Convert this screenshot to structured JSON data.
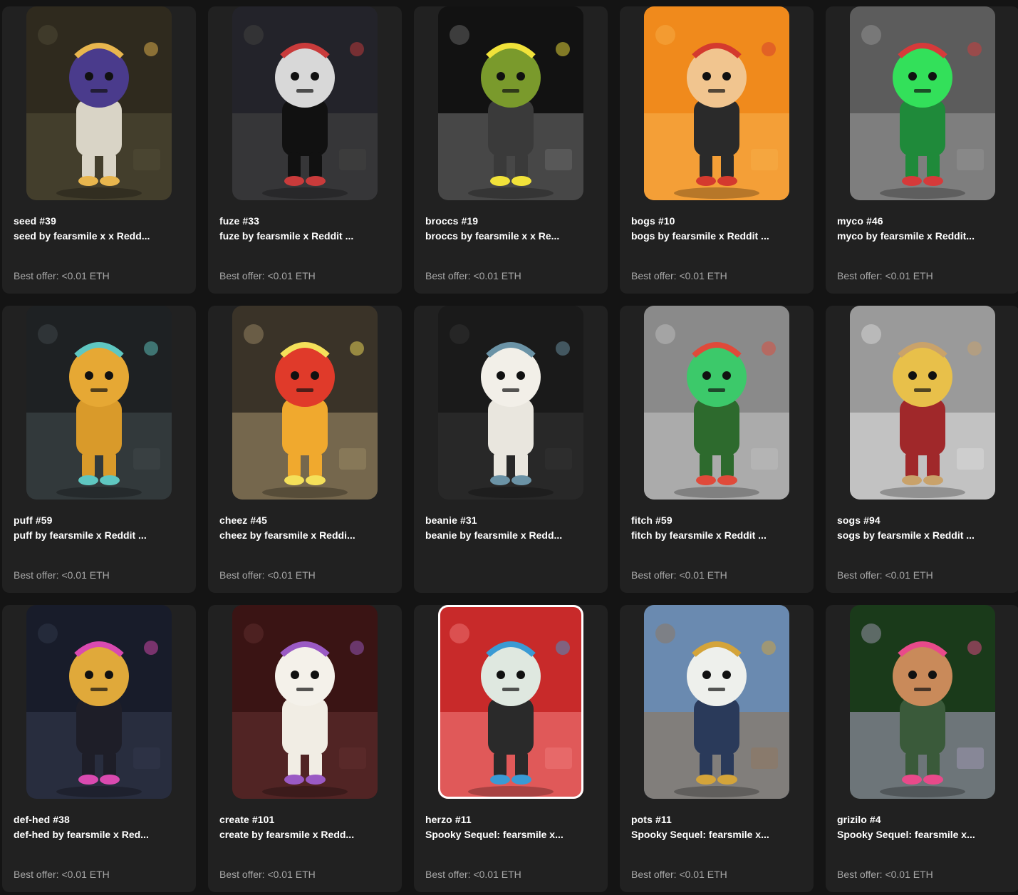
{
  "offer_prefix": "Best offer: ",
  "cards": [
    {
      "title": "seed #39",
      "subtitle": "seed by fearsmile x x Redd...",
      "offer": "Best offer: <0.01 ETH",
      "art": {
        "bg": "#2f2a1e",
        "mid": "#4b4632",
        "body": "#d9d4c6",
        "head": "#4a3b8c",
        "accent": "#e8b64e"
      }
    },
    {
      "title": "fuze #33",
      "subtitle": "fuze by fearsmile x Reddit ...",
      "offer": "Best offer: <0.01 ETH",
      "art": {
        "bg": "#23232a",
        "mid": "#3d3d3d",
        "body": "#111111",
        "head": "#d8d8d8",
        "accent": "#c93b3b"
      }
    },
    {
      "title": "broccs #19",
      "subtitle": "broccs by fearsmile x x Re...",
      "offer": "Best offer: <0.01 ETH",
      "art": {
        "bg": "#121212",
        "mid": "#5a5a5a",
        "body": "#3a3a3a",
        "head": "#7a9a2c",
        "accent": "#f1e23a"
      }
    },
    {
      "title": "bogs #10",
      "subtitle": "bogs by fearsmile x Reddit ...",
      "offer": "Best offer: <0.01 ETH",
      "art": {
        "bg": "#f08a1c",
        "mid": "#f5a640",
        "body": "#2a2a2a",
        "head": "#f1c58f",
        "accent": "#d43a2e"
      }
    },
    {
      "title": "myco #46",
      "subtitle": "myco by fearsmile x Reddit...",
      "offer": "Best offer: <0.01 ETH",
      "art": {
        "bg": "#5c5c5c",
        "mid": "#8a8a8a",
        "body": "#1f8a3a",
        "head": "#33e05a",
        "accent": "#d63a3a"
      }
    },
    {
      "title": "puff #59",
      "subtitle": "puff by fearsmile x Reddit ...",
      "offer": "Best offer: <0.01 ETH",
      "art": {
        "bg": "#1e2123",
        "mid": "#3a4144",
        "body": "#d99a2a",
        "head": "#e6a834",
        "accent": "#5fc7c1"
      }
    },
    {
      "title": "cheez #45",
      "subtitle": "cheez by fearsmile x Reddi...",
      "offer": "Best offer: <0.01 ETH",
      "art": {
        "bg": "#3a3328",
        "mid": "#8a7a5a",
        "body": "#f0a92e",
        "head": "#e03a2a",
        "accent": "#f4e05a"
      }
    },
    {
      "title": "beanie #31",
      "subtitle": "beanie by fearsmile x Redd...",
      "offer": "",
      "art": {
        "bg": "#1a1a1a",
        "mid": "#2e2e2e",
        "body": "#e9e6de",
        "head": "#f2efe8",
        "accent": "#6b93a6"
      }
    },
    {
      "title": "fitch #59",
      "subtitle": "fitch by fearsmile x Reddit ...",
      "offer": "Best offer: <0.01 ETH",
      "art": {
        "bg": "#8a8a8a",
        "mid": "#b5b5b5",
        "body": "#2d6a2d",
        "head": "#3cc96a",
        "accent": "#e04a3a"
      }
    },
    {
      "title": "sogs #94",
      "subtitle": "sogs by fearsmile x Reddit ...",
      "offer": "Best offer: <0.01 ETH",
      "art": {
        "bg": "#9a9a9a",
        "mid": "#cfcfcf",
        "body": "#a0282a",
        "head": "#e8c04a",
        "accent": "#c9a26a"
      }
    },
    {
      "title": "def-hed #38",
      "subtitle": "def-hed by fearsmile x Red...",
      "offer": "Best offer: <0.01 ETH",
      "art": {
        "bg": "#181c2a",
        "mid": "#2d3346",
        "body": "#1e1e28",
        "head": "#e0a93a",
        "accent": "#d94ab0"
      }
    },
    {
      "title": "create #101",
      "subtitle": "create by fearsmile x Redd...",
      "offer": "Best offer: <0.01 ETH",
      "art": {
        "bg": "#3a1414",
        "mid": "#5a2a2a",
        "body": "#f1ede4",
        "head": "#f4f1ea",
        "accent": "#9a5ac4"
      }
    },
    {
      "title": "herzo #11",
      "subtitle": "Spooky Sequel: fearsmile x...",
      "offer": "Best offer: <0.01 ETH",
      "art": {
        "bg": "#c82a2a",
        "mid": "#e86a6a",
        "body": "#2a2a2a",
        "head": "#dfe8e0",
        "accent": "#3a9ad4"
      }
    },
    {
      "title": "pots #11",
      "subtitle": "Spooky Sequel: fearsmile x...",
      "offer": "Best offer: <0.01 ETH",
      "art": {
        "bg": "#6a8ab0",
        "mid": "#8a7a6a",
        "body": "#2a3a5a",
        "head": "#eef0ec",
        "accent": "#d4a43a"
      }
    },
    {
      "title": "grizilo #4",
      "subtitle": "Spooky Sequel: fearsmile x...",
      "offer": "Best offer: <0.01 ETH",
      "art": {
        "bg": "#1a3a1a",
        "mid": "#8a8a9a",
        "body": "#3a5a3a",
        "head": "#c98a5a",
        "accent": "#e84a8a"
      }
    }
  ]
}
